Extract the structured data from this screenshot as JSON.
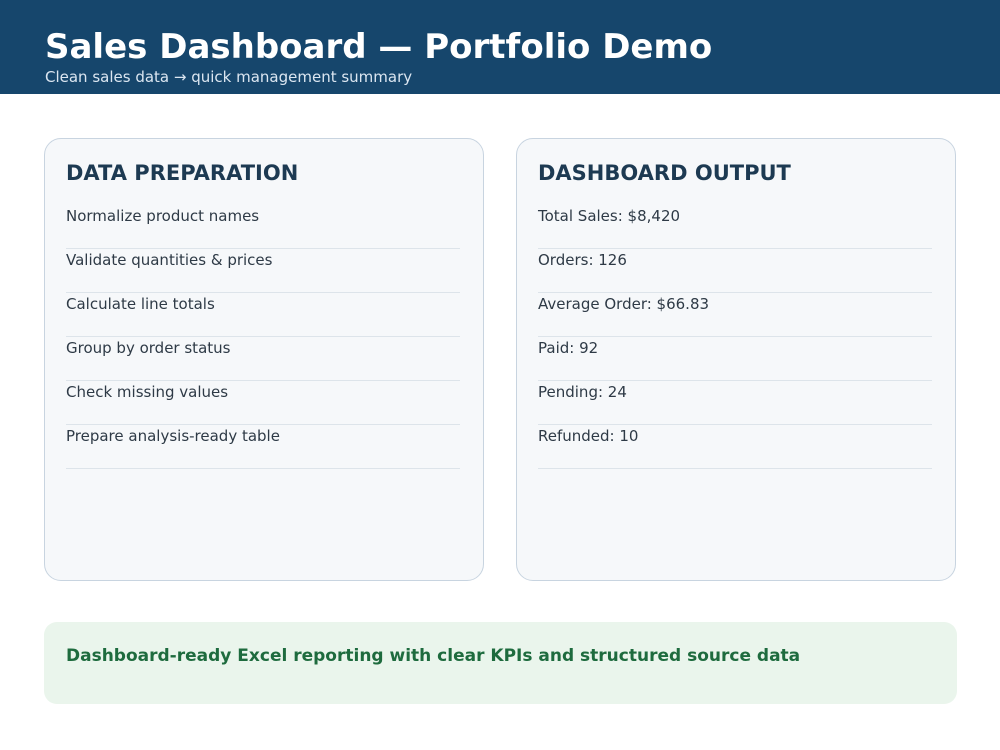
{
  "header": {
    "title": "Sales Dashboard — Portfolio Demo",
    "subtitle": "Clean sales data → quick management summary"
  },
  "data_preparation": {
    "heading": "DATA PREPARATION",
    "items": [
      "Normalize product names",
      "Validate quantities & prices",
      "Calculate line totals",
      "Group by order status",
      "Check missing values",
      "Prepare analysis-ready table"
    ]
  },
  "dashboard_output": {
    "heading": "DASHBOARD OUTPUT",
    "items": [
      "Total Sales: $8,420",
      "Orders: 126",
      "Average Order: $66.83",
      "Paid: 92",
      "Pending: 24",
      "Refunded: 10"
    ]
  },
  "banner": {
    "text": "Dashboard-ready Excel reporting with clear KPIs and structured source data"
  },
  "colors": {
    "header_bg": "#16466c",
    "card_bg": "#f6f8fa",
    "heading": "#1d3a52",
    "banner_bg": "#eaf5ec",
    "banner_text": "#1e6b3e"
  }
}
